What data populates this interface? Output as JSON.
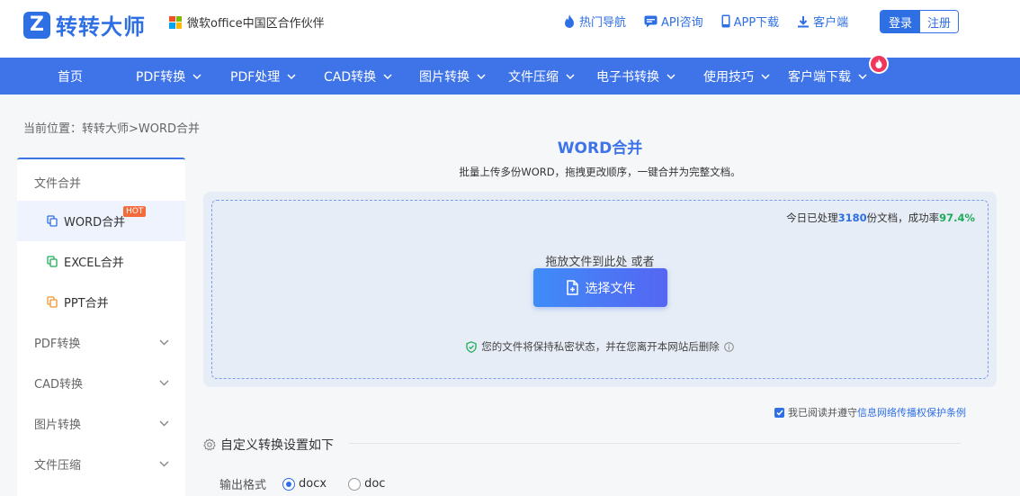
{
  "header": {
    "logo_text": "转转大师",
    "partner_text": "微软office中国区合作伙伴",
    "links": [
      "热门导航",
      "API咨询",
      "APP下载",
      "客户端"
    ],
    "login": "登录",
    "register": "注册"
  },
  "nav": {
    "items": [
      "首页",
      "PDF转换",
      "PDF处理",
      "CAD转换",
      "图片转换",
      "文件压缩",
      "电子书转换",
      "使用技巧",
      "客户端下载"
    ]
  },
  "breadcrumb": "当前位置：转转大师>WORD合并",
  "sidebar": {
    "group_title": "文件合并",
    "sub_items": [
      "WORD合并",
      "EXCEL合并",
      "PPT合并"
    ],
    "hot_tag": "HOT",
    "categories": [
      "PDF转换",
      "CAD转换",
      "图片转换",
      "文件压缩"
    ]
  },
  "main": {
    "title": "WORD合并",
    "subtitle": "批量上传多份WORD，拖拽更改顺序，一键合并为完整文档。",
    "stats_prefix": "今日已处理",
    "stats_count": "3180",
    "stats_middle": "份文档，成功率",
    "stats_rate": "97.4%",
    "drop_hint": "拖放文件到此处 或者",
    "select_button": "选择文件",
    "privacy_text": "您的文件将保持私密状态，并在您离开本网站后删除"
  },
  "agreement": {
    "prefix": "我已阅读并遵守",
    "link": "信息网络传播权保护条例"
  },
  "settings": {
    "title": "自定义转换设置如下",
    "format_label": "输出格式",
    "options": [
      "docx",
      "doc"
    ],
    "selected": "docx"
  },
  "colors": {
    "primary": "#3f74e8",
    "hot": "#f56a3b",
    "success": "#1ead5b"
  }
}
